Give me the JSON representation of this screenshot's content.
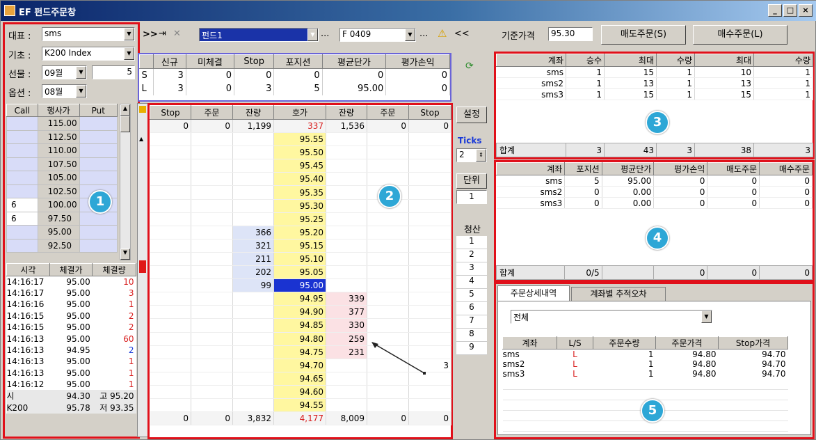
{
  "window": {
    "title": "EF 펀드주문창",
    "min": "_",
    "max": "□",
    "close": "×"
  },
  "left": {
    "rep_label": "대표 :",
    "rep_value": "sms",
    "base_label": "기초 :",
    "base_value": "K200 Index",
    "fut_label": "선물 :",
    "fut_value": "09월",
    "fut_num": "5",
    "opt_label": "옵션 :",
    "opt_value": "08월",
    "opt_header": [
      "Call",
      "행사가",
      "Put"
    ],
    "opt_rows": [
      [
        "",
        "115.00",
        ""
      ],
      [
        "",
        "112.50",
        ""
      ],
      [
        "",
        "110.00",
        ""
      ],
      [
        "",
        "107.50",
        ""
      ],
      [
        "",
        "105.00",
        ""
      ],
      [
        "",
        "102.50",
        ""
      ],
      [
        "6",
        "100.00",
        ""
      ],
      [
        "6",
        "97.50",
        ""
      ],
      [
        "",
        "95.00",
        ""
      ],
      [
        "",
        "92.50",
        ""
      ]
    ],
    "tick_header": [
      "시각",
      "체결가",
      "체결량"
    ],
    "tick_rows": [
      [
        "14:16:17",
        "95.00",
        "10",
        "r"
      ],
      [
        "14:16:17",
        "95.00",
        "3",
        "r"
      ],
      [
        "14:16:16",
        "95.00",
        "1",
        "r"
      ],
      [
        "14:16:15",
        "95.00",
        "2",
        "r"
      ],
      [
        "14:16:15",
        "95.00",
        "2",
        "r"
      ],
      [
        "14:16:13",
        "95.00",
        "60",
        "r"
      ],
      [
        "14:16:13",
        "94.95",
        "2",
        "b"
      ],
      [
        "14:16:13",
        "95.00",
        "1",
        "r"
      ],
      [
        "14:16:13",
        "95.00",
        "1",
        "r"
      ],
      [
        "14:16:12",
        "95.00",
        "1",
        "r"
      ]
    ],
    "ohlc1": [
      "시",
      "94.30",
      "고",
      "95.20"
    ],
    "ohlc2": [
      "K200",
      "95.78",
      "저",
      "93.35"
    ],
    "badge": "1"
  },
  "toolbar": {
    "arrows": ">>",
    "fund_value": "펀드1",
    "dots1": "...",
    "code_value": "F 0409",
    "dots2": "...",
    "back": "<<"
  },
  "summary": {
    "headers": [
      "신규",
      "미체결",
      "Stop",
      "포지션",
      "평균단가",
      "평가손익"
    ],
    "rows": [
      [
        "S",
        "3",
        "0",
        "0",
        "0",
        "0",
        "0"
      ],
      [
        "L",
        "3",
        "0",
        "3",
        "5",
        "95.00",
        "0"
      ]
    ]
  },
  "book": {
    "headers": [
      "Stop",
      "주문",
      "잔량",
      "호가",
      "잔량",
      "주문",
      "Stop"
    ],
    "top": [
      "0",
      "0",
      "1,199",
      "337",
      "1,536",
      "0",
      "0"
    ],
    "rows": [
      [
        "",
        "",
        "",
        "95.55",
        "",
        "",
        ""
      ],
      [
        "",
        "",
        "",
        "95.50",
        "",
        "",
        ""
      ],
      [
        "",
        "",
        "",
        "95.45",
        "",
        "",
        ""
      ],
      [
        "",
        "",
        "",
        "95.40",
        "",
        "",
        ""
      ],
      [
        "",
        "",
        "",
        "95.35",
        "",
        "",
        ""
      ],
      [
        "",
        "",
        "",
        "95.30",
        "",
        "",
        ""
      ],
      [
        "",
        "",
        "",
        "95.25",
        "",
        "",
        ""
      ],
      [
        "",
        "",
        "366",
        "95.20",
        "",
        "",
        ""
      ],
      [
        "",
        "",
        "321",
        "95.15",
        "",
        "",
        ""
      ],
      [
        "",
        "",
        "211",
        "95.10",
        "",
        "",
        ""
      ],
      [
        "",
        "",
        "202",
        "95.05",
        "",
        "",
        ""
      ],
      [
        "",
        "",
        "99",
        "95.00",
        "",
        "",
        ""
      ],
      [
        "",
        "",
        "",
        "94.95",
        "339",
        "",
        ""
      ],
      [
        "",
        "",
        "",
        "94.90",
        "377",
        "",
        ""
      ],
      [
        "",
        "",
        "",
        "94.85",
        "330",
        "",
        ""
      ],
      [
        "",
        "",
        "",
        "94.80",
        "259",
        "",
        ""
      ],
      [
        "",
        "",
        "",
        "94.75",
        "231",
        "",
        ""
      ],
      [
        "",
        "",
        "",
        "94.70",
        "",
        "",
        "3"
      ],
      [
        "",
        "",
        "",
        "94.65",
        "",
        "",
        ""
      ],
      [
        "",
        "",
        "",
        "94.60",
        "",
        "",
        ""
      ],
      [
        "",
        "",
        "",
        "94.55",
        "",
        "",
        ""
      ]
    ],
    "bottom": [
      "0",
      "0",
      "3,832",
      "4,177",
      "8,009",
      "0",
      "0"
    ],
    "badge": "2"
  },
  "mid": {
    "settings": "설정",
    "ticks_label": "Ticks",
    "ticks_value": "2",
    "unit_label": "단위",
    "unit_value": "1",
    "clear_label": "청산",
    "clear_items": [
      "1",
      "2",
      "3",
      "4",
      "5",
      "6",
      "7",
      "8",
      "9"
    ]
  },
  "right": {
    "base_price_label": "기준가격",
    "base_price_value": "95.30",
    "sell_btn": "매도주문(S)",
    "buy_btn": "매수주문(L)",
    "t3_headers": [
      "계좌",
      "승수",
      "최대",
      "수량",
      "최대",
      "수량"
    ],
    "t3_rows": [
      [
        "sms",
        "1",
        "15",
        "1",
        "10",
        "1"
      ],
      [
        "sms2",
        "1",
        "13",
        "1",
        "13",
        "1"
      ],
      [
        "sms3",
        "1",
        "15",
        "1",
        "15",
        "1"
      ]
    ],
    "t3_total": [
      "합계",
      "",
      "3",
      "43",
      "3",
      "38",
      "3"
    ],
    "t4_headers": [
      "계좌",
      "포지션",
      "평균단가",
      "평가손익",
      "매도주문",
      "매수주문"
    ],
    "t4_rows": [
      [
        "sms",
        "5",
        "95.00",
        "0",
        "0",
        "0"
      ],
      [
        "sms2",
        "0",
        "0.00",
        "0",
        "0",
        "0"
      ],
      [
        "sms3",
        "0",
        "0.00",
        "0",
        "0",
        "0"
      ]
    ],
    "t4_total": [
      "합계",
      "0/5",
      "",
      "0",
      "0",
      "0"
    ],
    "tabs": [
      "주문상세내역",
      "계좌별 추적오차"
    ],
    "filter_value": "전체",
    "t5_headers": [
      "계좌",
      "L/S",
      "주문수량",
      "주문가격",
      "Stop가격"
    ],
    "t5_rows": [
      [
        "sms",
        "L",
        "1",
        "94.80",
        "94.70"
      ],
      [
        "sms2",
        "L",
        "1",
        "94.80",
        "94.70"
      ],
      [
        "sms3",
        "L",
        "1",
        "94.80",
        "94.70"
      ]
    ],
    "badges": [
      "3",
      "4",
      "5"
    ]
  },
  "colors": {
    "red_box": "#e0101a",
    "badge": "#2ea7d6",
    "ask_bg": "#fff7a0",
    "bid_bg": "#dde4f7",
    "sell_bg": "#fbe1e4",
    "current": "#1a33d1"
  }
}
